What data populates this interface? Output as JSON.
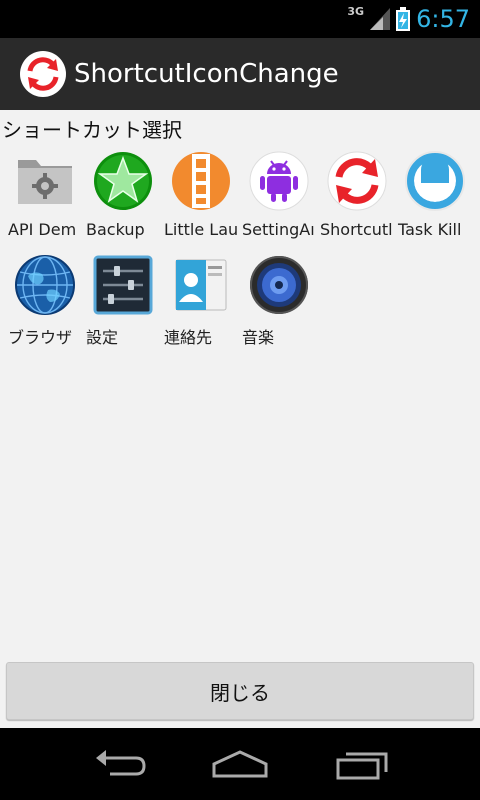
{
  "status_bar": {
    "network": "3G",
    "time": "6:57"
  },
  "action_bar": {
    "title": "ShortcutIconChange",
    "logo_icon": "refresh-arrows-icon"
  },
  "section": {
    "title": "ショートカット選択"
  },
  "apps": [
    {
      "label": "API Dem",
      "icon": "folder-gear-icon"
    },
    {
      "label": "Backup",
      "icon": "green-star-icon"
    },
    {
      "label": "Little Lau",
      "icon": "film-strip-icon"
    },
    {
      "label": "SettingAı",
      "icon": "android-robot-icon"
    },
    {
      "label": "Shortcutl",
      "icon": "refresh-arrows-icon"
    },
    {
      "label": "Task Kill",
      "icon": "face-icon"
    },
    {
      "label": "ブラウザ",
      "icon": "globe-icon"
    },
    {
      "label": "設定",
      "icon": "settings-sliders-icon"
    },
    {
      "label": "連絡先",
      "icon": "contacts-icon"
    },
    {
      "label": "音楽",
      "icon": "speaker-icon"
    }
  ],
  "close_button": {
    "label": "閉じる"
  },
  "nav": {
    "back_icon": "back-icon",
    "home_icon": "home-icon",
    "recents_icon": "recents-icon"
  },
  "colors": {
    "accent": "#33b5e5",
    "action_bar": "#2a2a2a",
    "background": "#f2f2f2"
  }
}
